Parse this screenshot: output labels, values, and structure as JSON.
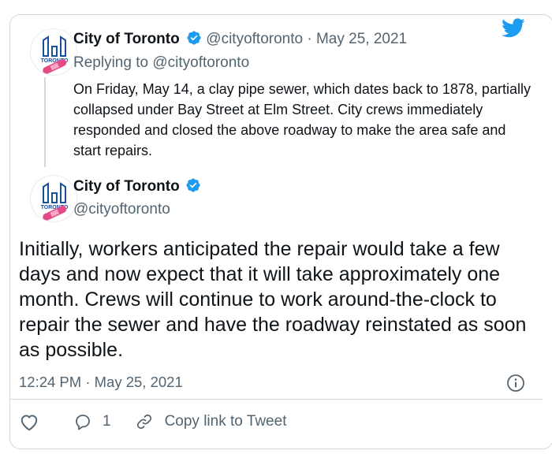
{
  "reply_tweet": {
    "display_name": "City of Toronto",
    "handle": "@cityoftoronto",
    "separator": "·",
    "date": "May 25, 2021",
    "replying_to_label": "Replying to",
    "replying_to_handle": "@cityoftoronto",
    "text": "On Friday, May 14, a clay pipe sewer, which dates back to 1878, partially collapsed under Bay Street at Elm Street. City crews immediately responded and closed the above roadway to make the area safe and start repairs."
  },
  "main_tweet": {
    "display_name": "City of Toronto",
    "handle": "@cityoftoronto",
    "text": "Initially, workers anticipated the repair would take a few days and now expect that it will take approximately one month. Crews will continue to work around-the-clock to repair the sewer and have the roadway reinstated as soon as possible.",
    "time": "12:24 PM",
    "separator": "·",
    "date": "May 25, 2021"
  },
  "actions": {
    "reply_count": "1",
    "copy_link_label": "Copy link to Tweet"
  },
  "avatar_text": "TORONTO",
  "icons": {
    "brand": "twitter-bird-icon",
    "verified": "verified-badge-icon",
    "like": "heart-icon",
    "reply": "reply-icon",
    "copy_link": "link-icon",
    "info": "info-icon"
  },
  "colors": {
    "brand_blue": "#1d9bf0",
    "text_primary": "#0f1419",
    "text_muted": "#536471",
    "border": "#cfd9de",
    "avatar_blue": "#1a4f9c",
    "bandage_pink": "#e54a86"
  }
}
